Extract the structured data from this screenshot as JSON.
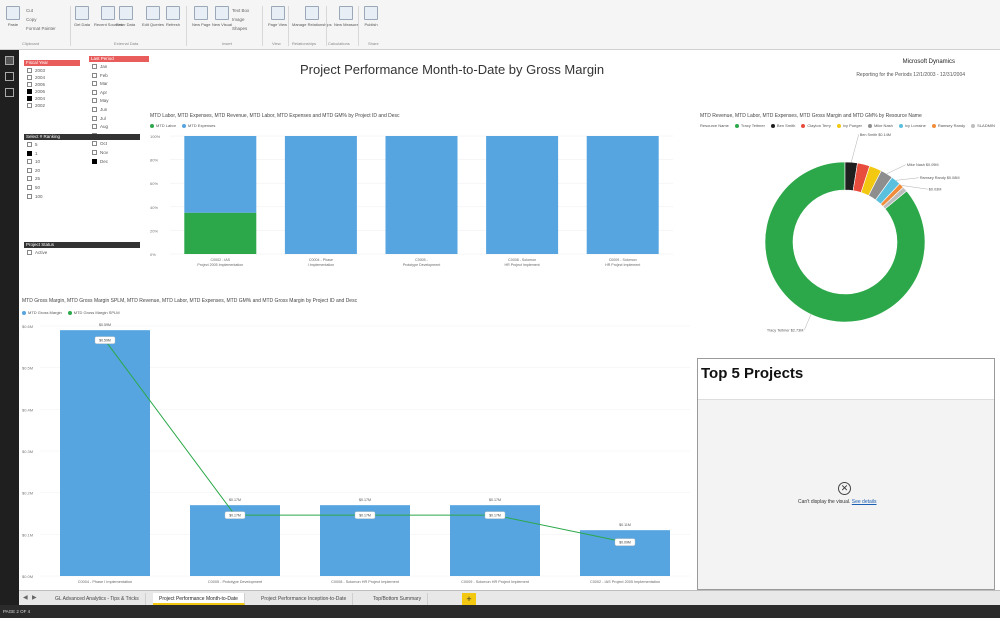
{
  "ribbon": {
    "clipboard": {
      "paste": "Paste",
      "cut": "Cut",
      "copy": "Copy",
      "format_painter": "Format Painter",
      "group": "Clipboard"
    },
    "external": {
      "buttons": [
        "Get Data",
        "Recent Sources",
        "Enter Data",
        "Edit Queries",
        "Refresh"
      ],
      "group": "External Data"
    },
    "insert": {
      "buttons": [
        "New Page",
        "New Visual"
      ],
      "small": [
        "Text Box",
        "Image",
        "Shapes"
      ],
      "group": "Insert"
    },
    "view": {
      "buttons": [
        "Page View"
      ],
      "group": "View"
    },
    "relationships": {
      "buttons": [
        "Manage Relationships"
      ],
      "group": "Relationships"
    },
    "calculations": {
      "buttons": [
        "New Measure"
      ],
      "group": "Calculations"
    },
    "share": {
      "buttons": [
        "Publish"
      ],
      "group": "Share"
    }
  },
  "report": {
    "title": "Project Performance Month-to-Date by Gross Margin",
    "brand": "Microsoft Dynamics",
    "period": "Reporting for the Periods 12/1/2003 - 12/31/2004"
  },
  "slicers": {
    "fiscal_year": {
      "title": "Fiscal Year",
      "items": [
        {
          "label": "2003",
          "on": false
        },
        {
          "label": "2004",
          "on": false
        },
        {
          "label": "2005",
          "on": false
        },
        {
          "label": "2006",
          "on": true
        },
        {
          "label": "2004",
          "on": true
        },
        {
          "label": "2002",
          "on": false
        }
      ]
    },
    "last_period": {
      "title": "Last Period",
      "items": [
        {
          "label": "Jan",
          "on": false
        },
        {
          "label": "Feb",
          "on": false
        },
        {
          "label": "Mar",
          "on": false
        },
        {
          "label": "Apr",
          "on": false
        },
        {
          "label": "May",
          "on": false
        },
        {
          "label": "Jun",
          "on": false
        },
        {
          "label": "Jul",
          "on": false
        },
        {
          "label": "Aug",
          "on": false
        },
        {
          "label": "Sep",
          "on": false
        },
        {
          "label": "Oct",
          "on": false
        },
        {
          "label": "Nov",
          "on": false
        },
        {
          "label": "Dec",
          "on": true
        }
      ]
    },
    "ranking": {
      "title": "Select # Ranking",
      "items": [
        {
          "label": "5",
          "on": false
        },
        {
          "label": "1",
          "on": true
        },
        {
          "label": "10",
          "on": false
        },
        {
          "label": "20",
          "on": false
        },
        {
          "label": "25",
          "on": false
        },
        {
          "label": "50",
          "on": false
        },
        {
          "label": "100",
          "on": false
        }
      ]
    },
    "project_status": {
      "title": "Project Status",
      "items": [
        {
          "label": "Active",
          "on": false
        }
      ]
    }
  },
  "chart_data": [
    {
      "type": "bar",
      "title": "MTD Labor, MTD Expenses, MTD Revenue, MTD Labor, MTD Expenses and MTD GM% by Project ID and Desc",
      "categories": [
        "C0002 - IAS Project 2005 Implementation",
        "C0004 - Phase I Implementation",
        "C0005 - Prototype Development",
        "C0008 - Solomon HR Project Implement",
        "C0009 - Solomon HR Project Implement"
      ],
      "series": [
        {
          "name": "MTD Labor",
          "values": [
            35,
            0,
            0,
            0,
            0
          ],
          "color": "#2ca84a"
        },
        {
          "name": "MTD Expenses",
          "values": [
            65,
            100,
            100,
            100,
            100
          ],
          "color": "#56a5e0"
        }
      ],
      "stacked": true,
      "yticks": [
        "100%",
        "80%",
        "60%",
        "40%",
        "20%",
        "0%"
      ],
      "ylim": [
        0,
        100
      ]
    },
    {
      "type": "pie",
      "title": "MTD Revenue, MTD Labor, MTD Expenses, MTD Gross Margin and MTD GM% by Resource Name",
      "legend_title": "Resource Name",
      "slices": [
        {
          "label": "Tracy Teitmer",
          "value": 86,
          "color": "#2ca84a",
          "data_label": "Tracy Teitmer $2.73M"
        },
        {
          "label": "Ben Smith",
          "value": 2.5,
          "color": "#1f1f1f",
          "data_label": "Ben Smith $0.14M"
        },
        {
          "label": "Clayton Terry",
          "value": 2.5,
          "color": "#e84c3d",
          "data_label": ""
        },
        {
          "label": "Ivy Pueger",
          "value": 2.5,
          "color": "#f2c811",
          "data_label": ""
        },
        {
          "label": "Mike Nash",
          "value": 2.5,
          "color": "#8e8e8e",
          "data_label": "Mike Nash $0.09M"
        },
        {
          "label": "Ivy Lorraine",
          "value": 2,
          "color": "#5bc0de",
          "data_label": "Ramsey Randy $0.08M"
        },
        {
          "label": "Ramsey Randy",
          "value": 1,
          "color": "#f08c3a",
          "data_label": "$0.03M"
        },
        {
          "label": "SLADMIN",
          "value": 1,
          "color": "#bdbdbd",
          "data_label": ""
        }
      ]
    },
    {
      "type": "bar",
      "title": "MTD Gross Margin, MTD Gross Margin SPLM, MTD Revenue, MTD Labor, MTD Expenses, MTD GM% and MTD Gross Margin by Project ID and Desc",
      "legend": [
        "MTD Gross Margin",
        "MTD Gross Margin SPLM"
      ],
      "categories": [
        "C0004 - Phase I Implementation",
        "C0005 - Prototype Development",
        "C0008 - Solomon HR Project Implement",
        "C0009 - Solomon HR Project Implement",
        "C0002 - IAS Project 2005 Implementation"
      ],
      "series": [
        {
          "name": "MTD Gross Margin",
          "values": [
            0.59,
            0.17,
            0.17,
            0.17,
            0.11
          ],
          "color": "#56a5e0"
        },
        {
          "name": "MTD Gross Margin SPLM",
          "values": [
            0.59,
            0.17,
            0.17,
            0.17,
            0.11
          ],
          "color": "#2ca84a"
        }
      ],
      "bar_labels": [
        "$0.59M",
        "$0.17M",
        "$0.17M",
        "$0.17M",
        "$0.11M"
      ],
      "line_labels": [
        "$0.59M",
        "$0.17M",
        "$0.17M",
        "$0.17M",
        "$0.09M"
      ],
      "yticks": [
        "$0.6M",
        "$0.5M",
        "$0.4M",
        "$0.3M",
        "$0.2M",
        "$0.1M",
        "$0.0M"
      ],
      "ylim": [
        0,
        0.6
      ]
    }
  ],
  "top5": {
    "title": "Top 5 Projects",
    "message": "Can't display the visual.",
    "link": "See details"
  },
  "tabs": [
    "GL Advanced Analytics - Tips & Tricks",
    "Project Performance Month-to-Date",
    "Project Performance Inception-to-Date",
    "Top/Bottom Summary"
  ],
  "active_tab": 1,
  "add_tab": "+",
  "status": "PAGE 2 OF 4"
}
